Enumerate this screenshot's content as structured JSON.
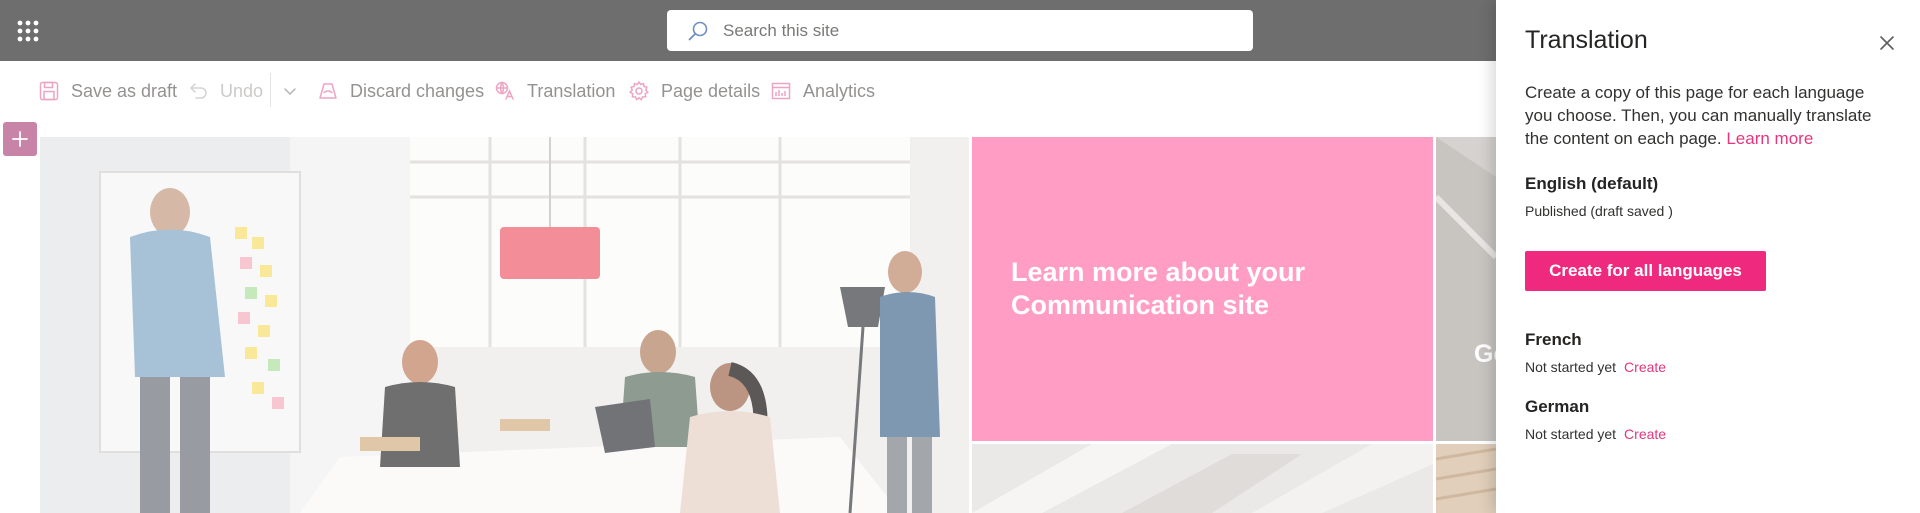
{
  "suite_bar": {
    "search_placeholder": "Search this site",
    "waffle_icon": "app-launcher-icon",
    "search_icon": "search-icon"
  },
  "command_bar": {
    "save_draft": "Save as draft",
    "undo": "Undo",
    "discard": "Discard changes",
    "translation": "Translation",
    "page_details": "Page details",
    "analytics": "Analytics"
  },
  "hero": {
    "tile_title": "Learn more about your Communication site",
    "right_tile_text": "Ge lo"
  },
  "translation_panel": {
    "title": "Translation",
    "description": "Create a copy of this page for each language you choose. Then, you can manually translate the content on each page.",
    "learn_more": "Learn more",
    "default_language": "English (default)",
    "default_status": "Published (draft saved )",
    "create_all_button": "Create for all languages",
    "languages": [
      {
        "name": "French",
        "status": "Not started yet",
        "action": "Create"
      },
      {
        "name": "German",
        "status": "Not started yet",
        "action": "Create"
      }
    ]
  },
  "colors": {
    "suite_bar": "#6e6e6e",
    "accent": "#ef2a7e",
    "tile_pink": "#ff82b4",
    "add_button": "#b8628d"
  }
}
